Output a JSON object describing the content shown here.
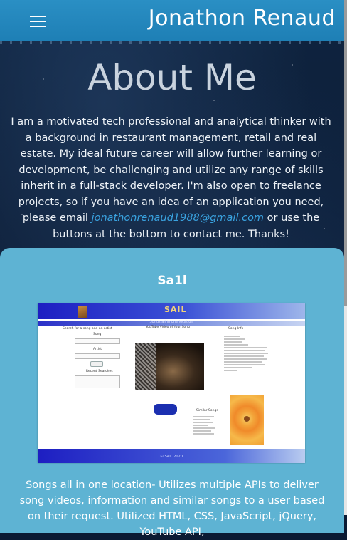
{
  "navbar": {
    "brand": "Jonathon Renaud",
    "menu_icon": "hamburger-menu-icon"
  },
  "about": {
    "title": "About Me",
    "text_before": "I am a motivated tech professional and analytical thinker with a background in restaurant management, retail and real estate. My ideal future career will allow further learning or development, be challenging and utilize any range of skills inherit in a full-stack developer. I'm also open to freelance projects, so if you have an idea of an application you need, please email ",
    "email": "jonathonrenaud1988@gmail.com",
    "text_after": " or use the buttons at the bottom to contact me. Thanks!"
  },
  "project": {
    "title": "Sa1l",
    "screenshot": {
      "brand": "SAIL",
      "subtitle": "Songs all in one location",
      "search_title": "Search for a song and an artist",
      "song_label": "Song",
      "artist_label": "Artist",
      "recent_label": "Recent Searches",
      "video_title": "YouTube Video of Your Song",
      "info_title": "Song Info",
      "similar_title": "Similar Songs",
      "footer": "© SAIL 2020"
    },
    "description": "Songs all in one location- Utilizes multiple APIs to deliver song videos, information and similar songs to a user based on their request. Utilized HTML, CSS, JavaScript, jQuery, YouTube API,"
  },
  "colors": {
    "navbar": "#1e7fb5",
    "card": "#5eb3d3",
    "link": "#3aa3e0",
    "background": "#0b1a33"
  }
}
